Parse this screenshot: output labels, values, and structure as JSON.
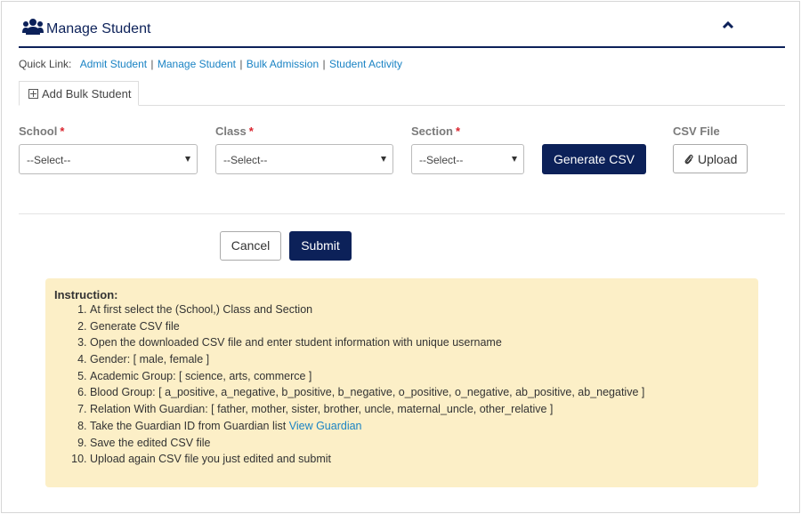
{
  "header": {
    "title": "Manage Student",
    "icon": "users-icon",
    "collapse_icon": "chevron-up-icon"
  },
  "quick_links": {
    "prefix": "Quick Link:",
    "items": [
      "Admit Student",
      "Manage Student",
      "Bulk Admission",
      "Student Activity"
    ],
    "separator": "|"
  },
  "tab": {
    "label": "Add Bulk Student",
    "icon": "plus-square-icon"
  },
  "form": {
    "school": {
      "label": "School",
      "required": "*",
      "value": "--Select--"
    },
    "class": {
      "label": "Class",
      "required": "*",
      "value": "--Select--"
    },
    "section": {
      "label": "Section",
      "required": "*",
      "value": "--Select--"
    },
    "generate_csv": "Generate CSV",
    "csv_file": {
      "label": "CSV File",
      "upload": "Upload",
      "icon": "paperclip-icon"
    }
  },
  "actions": {
    "cancel": "Cancel",
    "submit": "Submit"
  },
  "instruction": {
    "heading": "Instruction:",
    "steps": [
      "At first select the (School,) Class and Section",
      "Generate CSV file",
      "Open the downloaded CSV file and enter student information with unique username",
      "Gender: [ male, female ]",
      "Academic Group: [ science, arts, commerce ]",
      "Blood Group: [ a_positive, a_negative, b_positive, b_negative, o_positive, o_negative, ab_positive, ab_negative ]",
      "Relation With Guardian: [ father, mother, sister, brother, uncle, maternal_uncle, other_relative ]",
      "Take the Guardian ID from Guardian list",
      "Save the edited CSV file",
      "Upload again CSV file you just edited and submit"
    ],
    "step8_link": "View Guardian"
  },
  "colors": {
    "primary": "#0c2159",
    "link": "#1a83c4",
    "required": "#d9232d",
    "instruction_bg": "#fcefc7"
  }
}
